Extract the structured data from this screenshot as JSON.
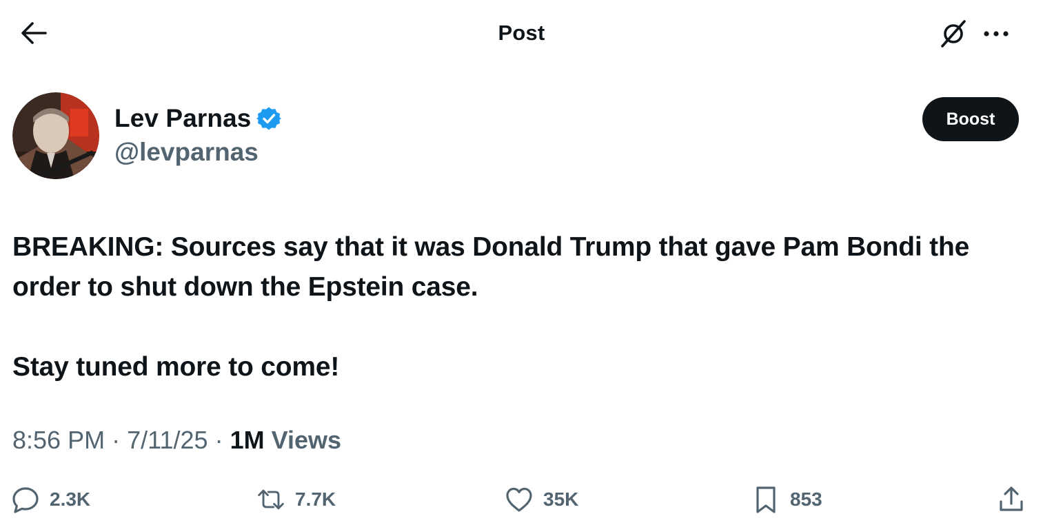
{
  "header": {
    "title": "Post",
    "back_icon": "arrow-left-icon",
    "grok_icon": "grok-icon",
    "more_icon": "more-horizontal-icon"
  },
  "author": {
    "display_name": "Lev Parnas",
    "handle": "@levparnas",
    "verified": true,
    "verified_color": "#1d9bf0",
    "boost_label": "Boost"
  },
  "post": {
    "paragraphs": [
      "BREAKING: Sources say that it was Donald Trump that gave Pam Bondi the order to shut down the Epstein case.",
      "Stay tuned more to come!"
    ],
    "time": "8:56 PM",
    "separator": "·",
    "date": "7/11/25",
    "views_count": "1M",
    "views_label": "Views"
  },
  "actions": {
    "replies": "2.3K",
    "reposts": "7.7K",
    "likes": "35K",
    "bookmarks": "853"
  },
  "colors": {
    "text": "#0f1419",
    "secondary": "#536471",
    "accent": "#1d9bf0",
    "button": "#0f1419"
  }
}
